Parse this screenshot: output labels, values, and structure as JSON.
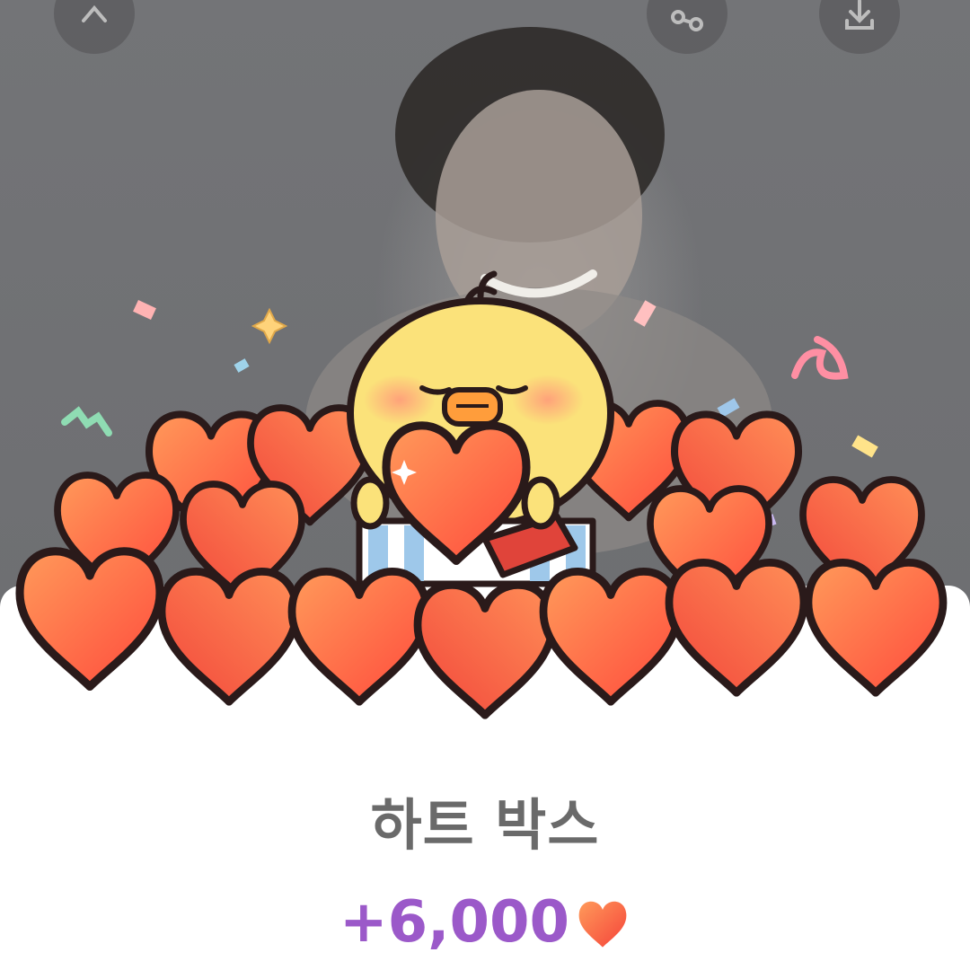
{
  "toolbar": {
    "close_icon": "close-icon",
    "share_icon": "share-icon",
    "download_icon": "download-icon"
  },
  "reward": {
    "title": "하트 박스",
    "amount": "+6,000",
    "currency_icon": "heart-icon"
  },
  "colors": {
    "amount": "#9b59c9",
    "title": "#6a6a6a",
    "heart": "#ff5a4a",
    "sheet": "#ffffff"
  }
}
